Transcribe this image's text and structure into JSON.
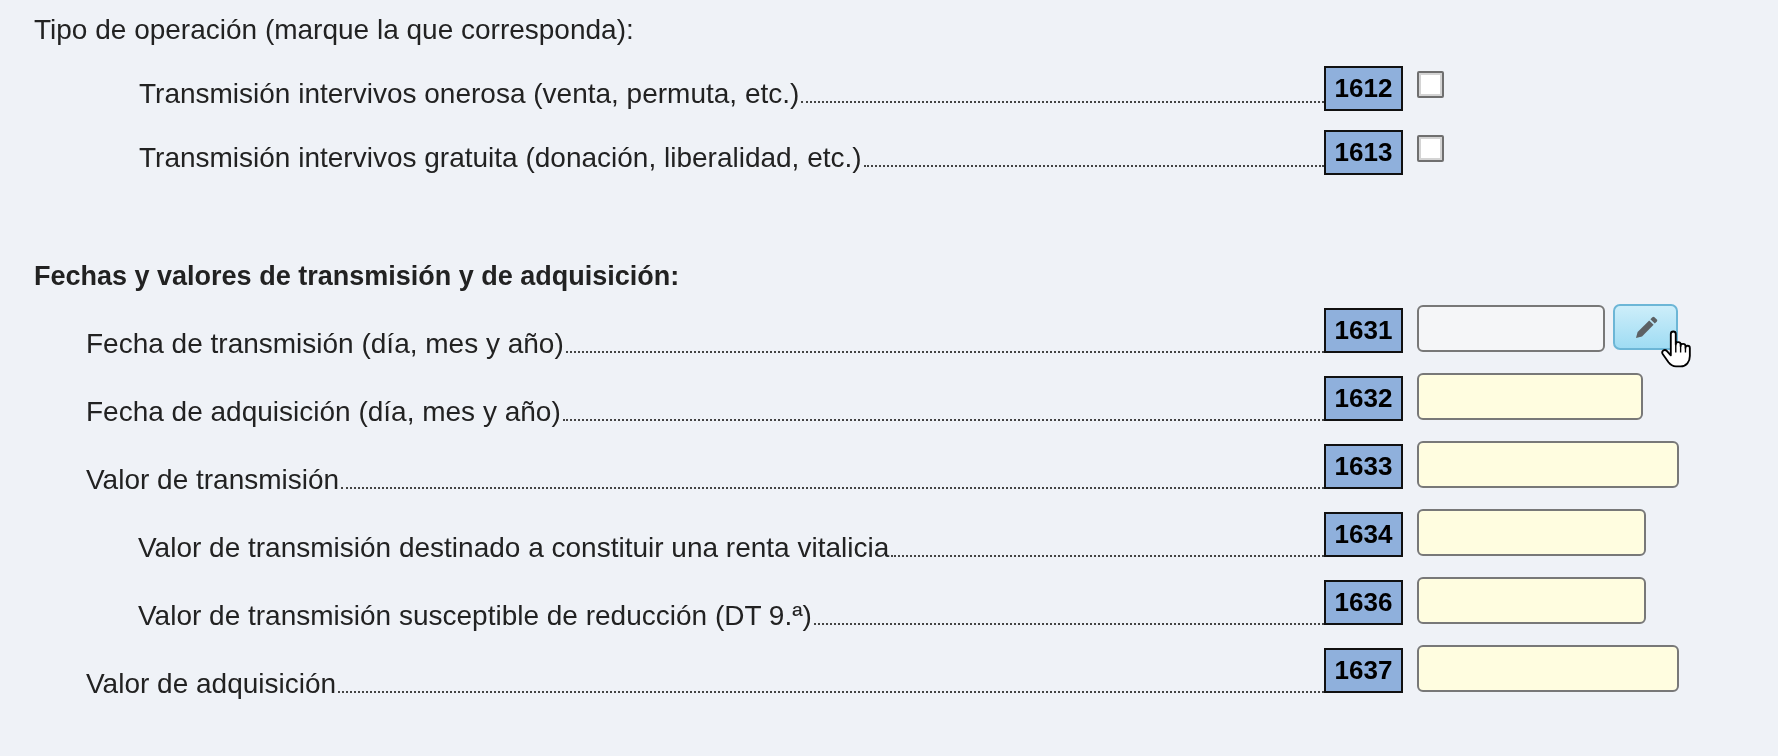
{
  "sections": [
    {
      "kind": "prompt",
      "title": "Tipo de operación (marque la que corresponda):",
      "rows": [
        {
          "label": "Transmisión intervivos onerosa (venta, permuta, etc.)",
          "code": "1612",
          "kind": "checkbox",
          "checked": false
        },
        {
          "label": "Transmisión intervivos gratuita (donación, liberalidad, etc.)",
          "code": "1613",
          "kind": "checkbox",
          "checked": false
        }
      ]
    },
    {
      "kind": "heading",
      "title": "Fechas y valores de transmisión y de adquisición:",
      "rows": [
        {
          "label": "Fecha de transmisión (día, mes y año)",
          "code": "1631",
          "kind": "date",
          "readonly": true,
          "edit_button": {
            "hovered": true
          }
        },
        {
          "label": "Fecha de adquisición (día, mes y año)",
          "code": "1632",
          "kind": "date",
          "readonly": false
        },
        {
          "label": "Valor de transmisión",
          "code": "1633",
          "kind": "amount",
          "readonly": false,
          "children": [
            {
              "label": "Valor de transmisión destinado a constituir una renta vitalicia",
              "code": "1634",
              "kind": "amount",
              "readonly": false
            },
            {
              "label": "Valor de transmisión susceptible de reducción (DT 9.ª)",
              "code": "1636",
              "kind": "amount",
              "readonly": false
            }
          ]
        },
        {
          "label": "Valor de adquisición",
          "code": "1637",
          "kind": "amount",
          "readonly": false
        }
      ]
    }
  ]
}
